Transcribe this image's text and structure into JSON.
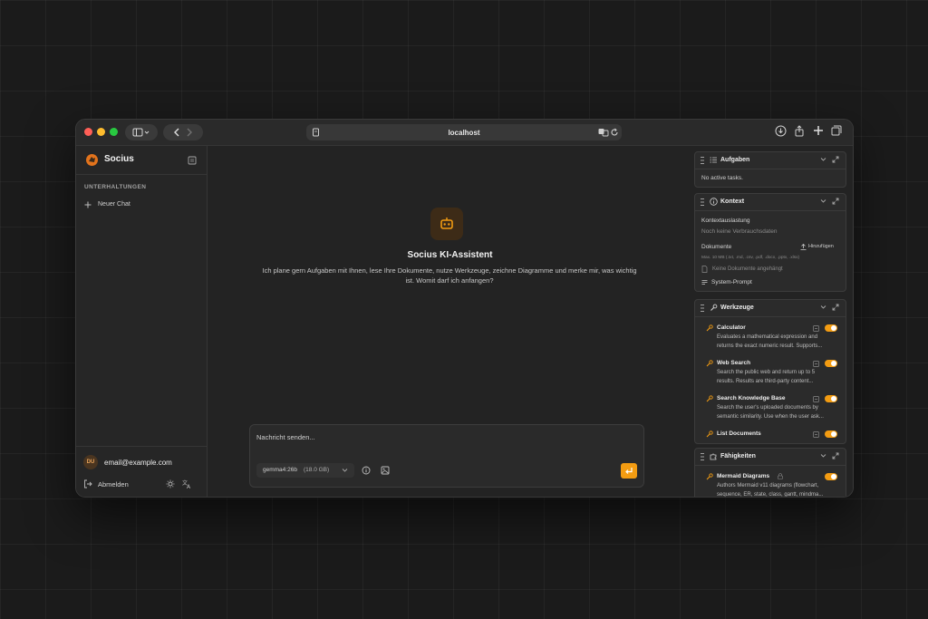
{
  "browser": {
    "url": "localhost"
  },
  "sidebar": {
    "app_name": "Socius",
    "section_heading": "UNTERHALTUNGEN",
    "new_chat_label": "Neuer Chat",
    "user": {
      "initials": "DU",
      "email": "email@example.com"
    },
    "logout_label": "Abmelden"
  },
  "main": {
    "welcome_title": "Socius KI-Assistent",
    "welcome_text": "Ich plane gern Aufgaben mit Ihnen, lese Ihre Dokumente, nutze Werkzeuge, zeichne Diagramme und merke mir, was wichtig ist. Womit darf ich anfangen?",
    "composer": {
      "placeholder": "Nachricht senden...",
      "model": "gemma4:26b",
      "model_size": "(18.0 GB)"
    }
  },
  "panels": {
    "tasks": {
      "title": "Aufgaben",
      "empty_text": "No active tasks."
    },
    "context": {
      "title": "Kontext",
      "usage_label": "Kontextauslastung",
      "usage_empty": "Noch keine Verbrauchsdaten",
      "documents_label": "Dokumente",
      "add_label": "Hinzufügen",
      "file_hint": "Max. 10 MB (.txt, .md, .csv, .pdf, .docx, .pptx, .xlsx)",
      "no_documents": "Keine Dokumente angehängt",
      "system_prompt_label": "System-Prompt"
    },
    "tools": {
      "title": "Werkzeuge",
      "items": [
        {
          "name": "Calculator",
          "desc": "Evaluates a mathematical expression and returns the exact numeric result. Supports...",
          "enabled": true
        },
        {
          "name": "Web Search",
          "desc": "Search the public web and return up to 5 results. Results are third-party content...",
          "enabled": true
        },
        {
          "name": "Search Knowledge Base",
          "desc": "Search the user's uploaded documents by semantic similarity. Use when the user ask...",
          "enabled": true
        },
        {
          "name": "List Documents",
          "desc": "",
          "enabled": true
        }
      ]
    },
    "skills": {
      "title": "Fähigkeiten",
      "items": [
        {
          "name": "Mermaid Diagrams",
          "desc": "Authors Mermaid v11 diagrams (flowchart, sequence, ER, state, class, gantt, mindma...",
          "enabled": true
        }
      ]
    }
  },
  "colors": {
    "accent": "#f39c12",
    "window_bg": "#242424",
    "panel_bg": "#2b2b2b"
  }
}
